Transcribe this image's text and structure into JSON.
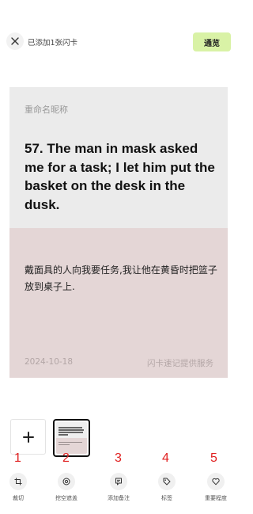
{
  "header": {
    "status_text": "已添加1张闪卡",
    "preview_label": "通览"
  },
  "card": {
    "nickname": "重命名昵称",
    "question": "57. The man in mask asked me for a task; I let him put the basket on the desk in the dusk.",
    "answer": "戴面具的人向我要任务,我让他在黄昏时把篮子放到桌子上.",
    "date": "2024-10-18",
    "footer": "闪卡速记提供服务",
    "colors": {
      "front_bg": "#ebebeb",
      "back_bg": "#e4d6d6"
    }
  },
  "markers": [
    "1",
    "2",
    "3",
    "4",
    "5"
  ],
  "toolbar": [
    {
      "label": "裁切",
      "icon": "crop-icon"
    },
    {
      "label": "挖空遮盖",
      "icon": "cloze-icon"
    },
    {
      "label": "添加备注",
      "icon": "note-icon"
    },
    {
      "label": "标签",
      "icon": "tag-icon"
    },
    {
      "label": "重要程度",
      "icon": "heart-icon"
    }
  ],
  "colors": {
    "accent": "#d9f2a6",
    "marker": "#e02020"
  }
}
